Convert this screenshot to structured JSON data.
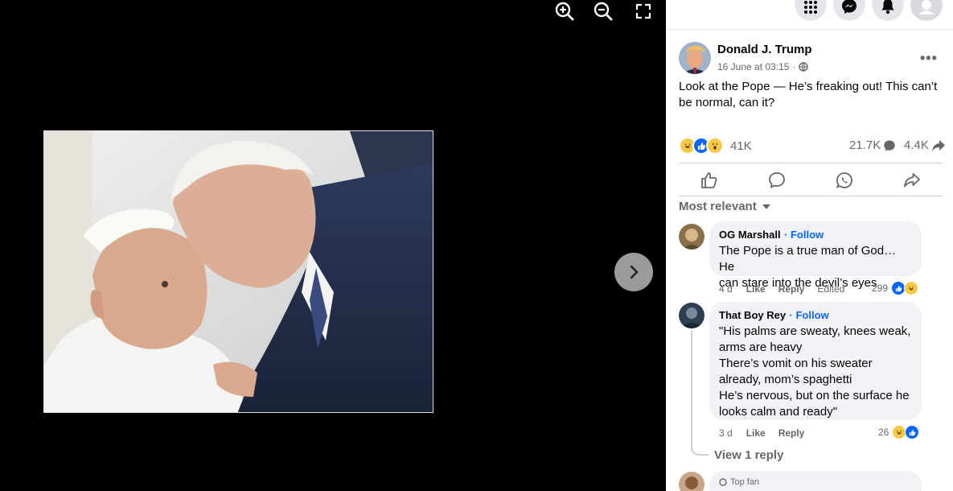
{
  "viewer": {
    "controls": [
      "zoom-in-icon",
      "zoom-out-icon",
      "fullscreen-icon"
    ],
    "next_icon": "chevron-right-icon"
  },
  "topbar": {
    "icons": [
      "menu-grid-icon",
      "messenger-icon",
      "notifications-bell-icon",
      "account-avatar"
    ]
  },
  "post": {
    "author": "Donald J. Trump",
    "date": "16 June at 03:15",
    "separator": "·",
    "privacy_icon": "globe-icon",
    "more_label": "•••",
    "text": "Look at the Pope — He’s freaking out! This can’t be normal, can it?",
    "reactions": {
      "icons": [
        "haha",
        "like",
        "wow"
      ],
      "count": "41K"
    },
    "comments_count": "21.7K",
    "shares_count": "4.4K"
  },
  "actions": [
    "like-icon",
    "comment-icon",
    "whatsapp-icon",
    "share-icon"
  ],
  "sort_label": "Most relevant",
  "comments": [
    {
      "name": "OG Marshall",
      "follow": "· Follow",
      "text_lines": [
        "The Pope is a true man of God… He",
        "can stare into the devil’s eyes"
      ],
      "time": "4 d",
      "like": "Like",
      "reply": "Reply",
      "edited": "Edited",
      "reaction_count": "299"
    },
    {
      "name": "That Boy Rey",
      "follow": "· Follow",
      "text_lines": [
        "\"His palms are sweaty, knees weak,",
        "arms are heavy",
        "There’s vomit on his sweater",
        "already, mom’s spaghetti",
        "He’s nervous, but on the surface he",
        "looks calm and ready\""
      ],
      "time": "3 d",
      "like": "Like",
      "reply": "Reply",
      "reaction_count": "26"
    }
  ],
  "view_reply": "View 1 reply",
  "next_comment_badge": "Top fan",
  "colors": {
    "facebook_blue": "#0866ff",
    "panel_bg": "#ffffff",
    "bubble_bg": "#f0f2f5",
    "viewer_bg": "#000000"
  }
}
